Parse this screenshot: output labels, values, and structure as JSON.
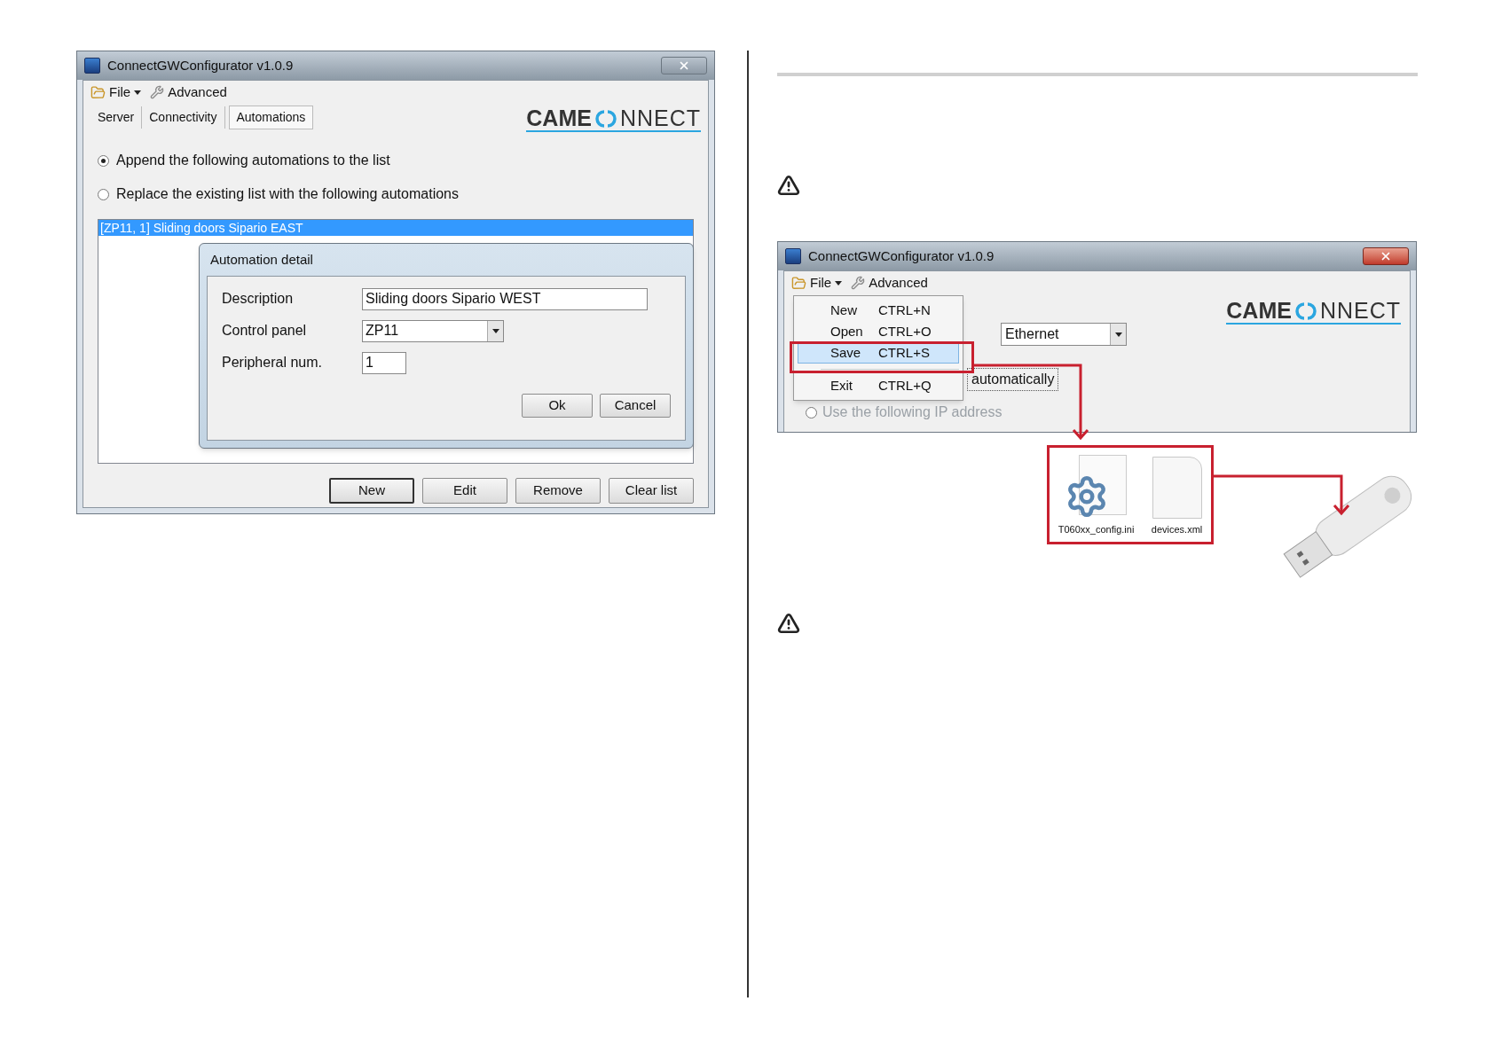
{
  "left_window": {
    "title": "ConnectGWConfigurator v1.0.9",
    "menu": [
      {
        "kind": "file",
        "label": "File"
      },
      {
        "kind": "advanced",
        "label": "Advanced"
      }
    ],
    "tabs": [
      {
        "label": "Server",
        "selected": false
      },
      {
        "label": "Connectivity",
        "selected": false
      },
      {
        "label": "Automations",
        "selected": true
      }
    ],
    "logo": {
      "bold": "CAME",
      "light": "NNECT"
    },
    "options": [
      {
        "label": "Append the following automations to the list",
        "selected": true
      },
      {
        "label": "Replace the existing list with the following automations",
        "selected": false
      }
    ],
    "list": [
      {
        "text": "[ZP11, 1] Sliding doors Sipario EAST",
        "selected": true
      }
    ],
    "dialog": {
      "title": "Automation detail",
      "fields": [
        {
          "kind": "text",
          "label": "Description",
          "value": "Sliding doors Sipario WEST"
        },
        {
          "kind": "select",
          "label": "Control panel",
          "value": "ZP11"
        },
        {
          "kind": "number",
          "label": "Peripheral num.",
          "value": "1"
        }
      ],
      "buttons": [
        "Ok",
        "Cancel"
      ]
    },
    "buttons": [
      {
        "label": "New",
        "default": true
      },
      {
        "label": "Edit",
        "default": false
      },
      {
        "label": "Remove",
        "default": false
      },
      {
        "label": "Clear list",
        "default": false
      }
    ]
  },
  "right_window": {
    "title": "ConnectGWConfigurator v1.0.9",
    "menu": [
      {
        "kind": "file",
        "label": "File"
      },
      {
        "kind": "advanced",
        "label": "Advanced"
      }
    ],
    "file_menu": [
      {
        "label": "New",
        "shortcut": "CTRL+N",
        "selected": false
      },
      {
        "label": "Open",
        "shortcut": "CTRL+O",
        "selected": false
      },
      {
        "label": "Save",
        "shortcut": "CTRL+S",
        "selected": true
      },
      {
        "label": "Exit",
        "shortcut": "CTRL+Q",
        "selected": false
      }
    ],
    "logo": {
      "bold": "CAME",
      "light": "NNECT"
    },
    "connection": "Ethernet",
    "auto_label": "automatically",
    "ip_option": {
      "label": "Use the following IP address",
      "selected": false
    }
  },
  "files": [
    {
      "kind": "config",
      "name": "T060xx_config.ini"
    },
    {
      "kind": "document",
      "name": "devices.xml"
    }
  ]
}
